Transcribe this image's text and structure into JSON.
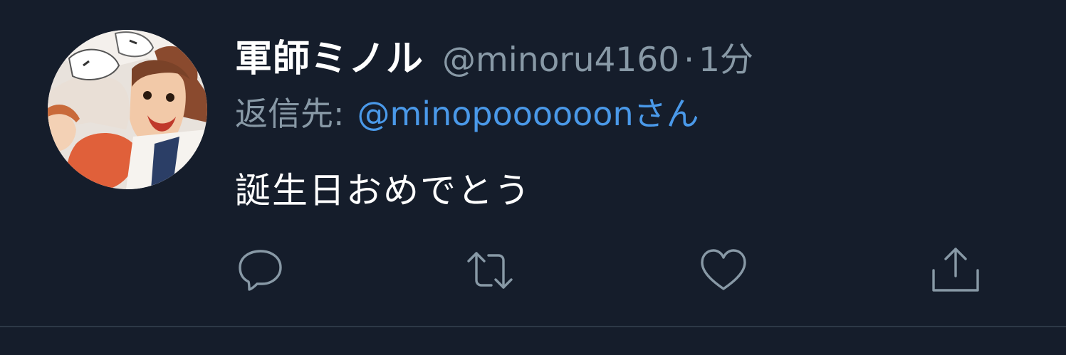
{
  "tweet": {
    "display_name": "軍師ミノル",
    "handle": "@minoru4160",
    "separator": "·",
    "time": "1分",
    "reply_prefix": "返信先:",
    "reply_target": "@minopoooooonさん",
    "text": "誕生日おめでとう"
  },
  "actions": [
    {
      "name": "reply",
      "icon": "reply-icon"
    },
    {
      "name": "retweet",
      "icon": "retweet-icon"
    },
    {
      "name": "like",
      "icon": "heart-icon"
    },
    {
      "name": "share",
      "icon": "share-icon"
    }
  ],
  "colors": {
    "background": "#151d2b",
    "primary_text": "#ffffff",
    "secondary_text": "#8899a6",
    "link": "#4a99e9",
    "divider": "#2d3947"
  }
}
